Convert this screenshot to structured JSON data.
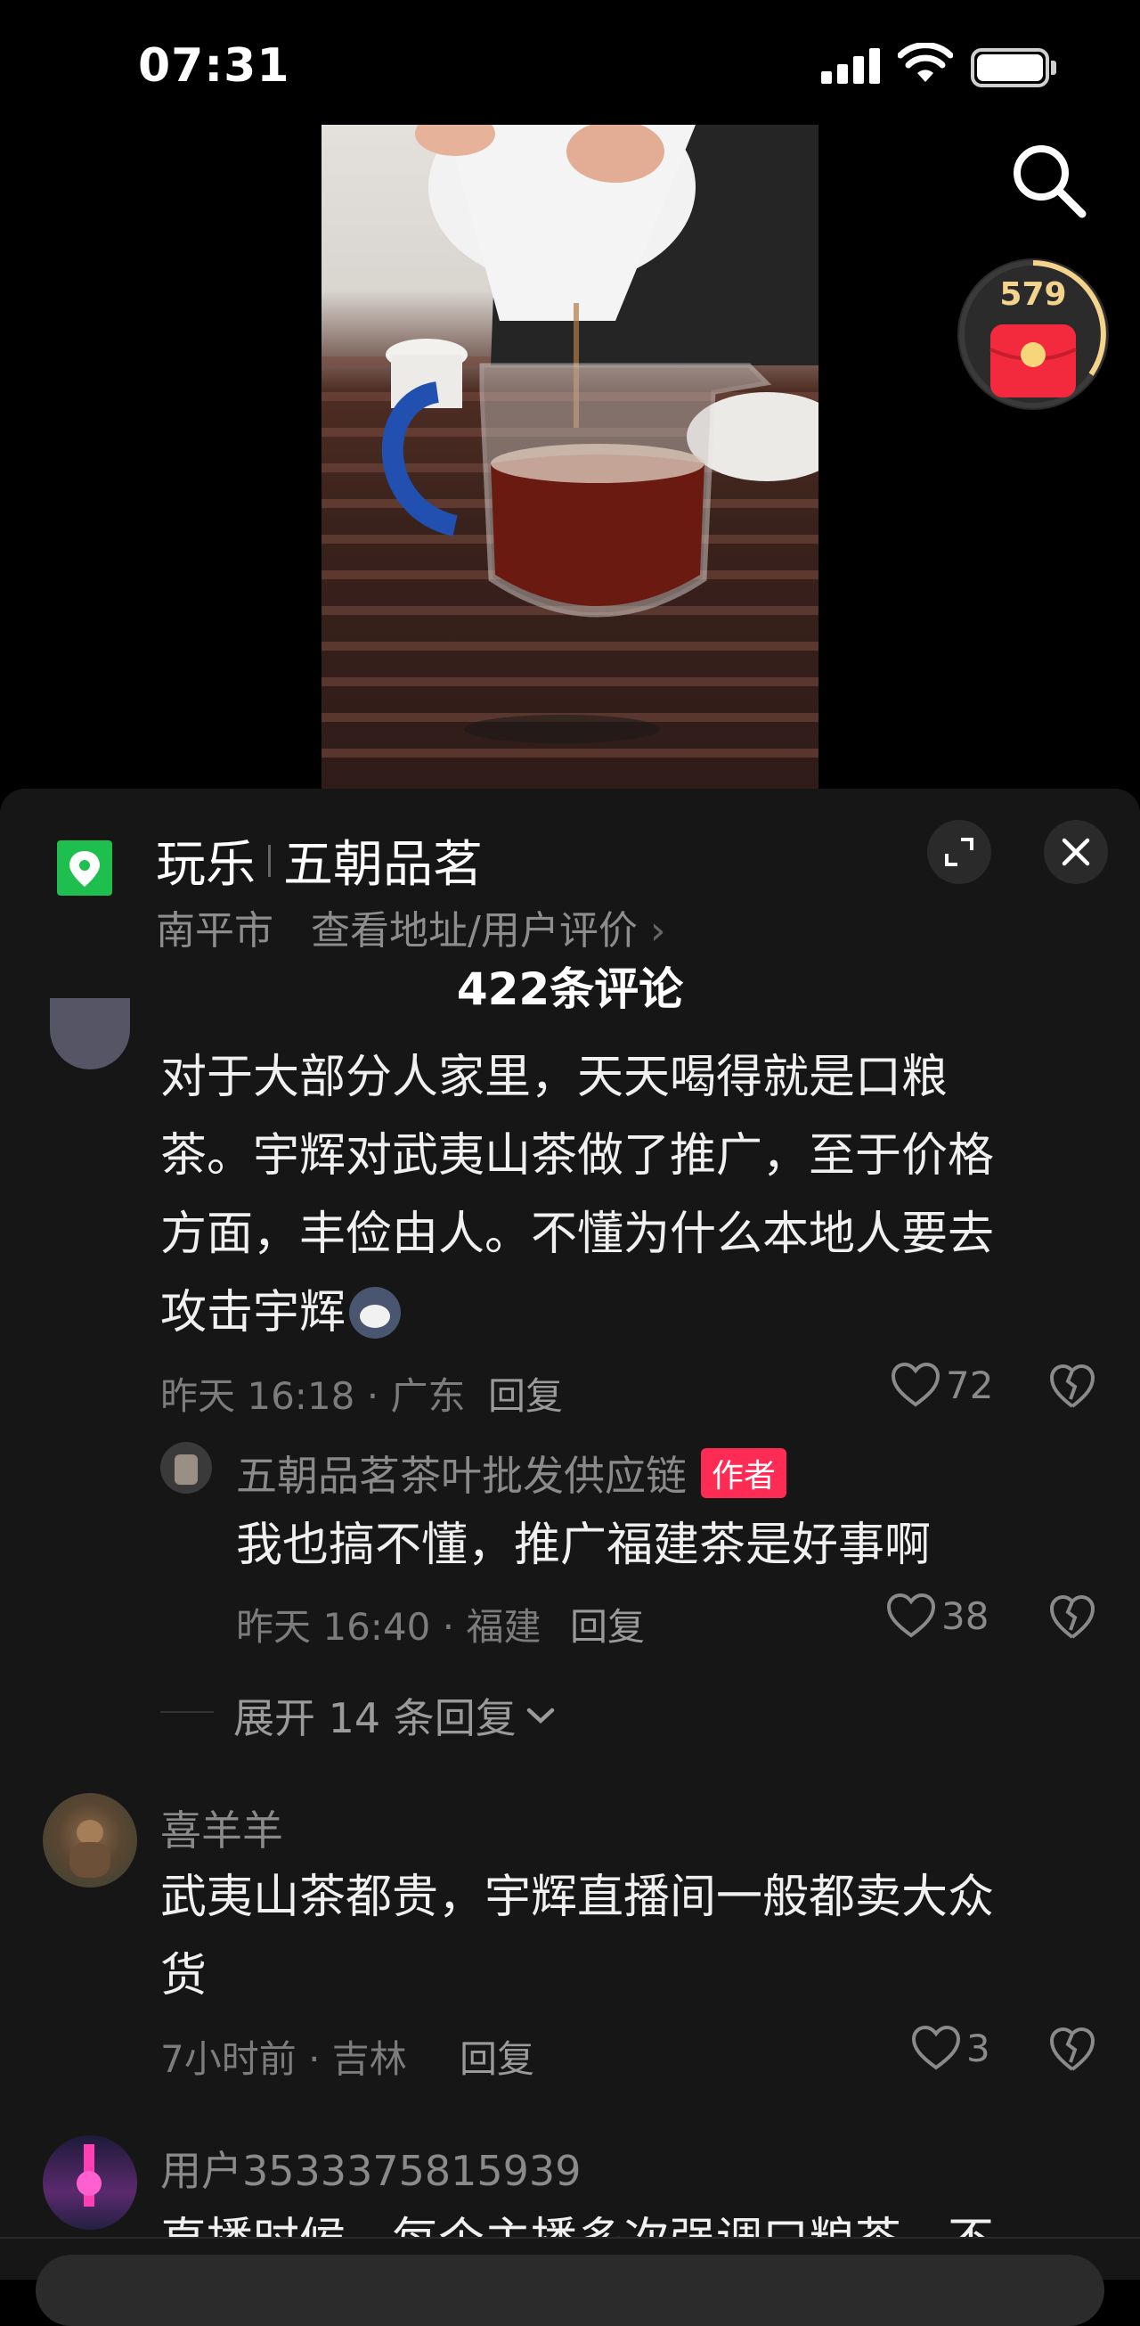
{
  "status_bar": {
    "time": "07:31"
  },
  "red_packet": {
    "count": "579"
  },
  "location": {
    "category": "玩乐",
    "name": "五朝品茗",
    "city": "南平市",
    "link_text": "查看地址/用户评价"
  },
  "comments_header": {
    "count_label": "422条评论"
  },
  "comments": [
    {
      "text_lines": [
        "对于大部分人家里，天天喝得就是口粮",
        "茶。宇辉对武夷山茶做了推广，至于价格",
        "方面，丰俭由人。不懂为什么本地人要去",
        "攻击宇辉"
      ],
      "meta": "昨天 16:18 · 广东",
      "reply_label": "回复",
      "likes": "72"
    },
    {
      "user": "五朝品茗茶叶批发供应链",
      "badge": "作者",
      "text": "我也搞不懂，推广福建茶是好事啊",
      "meta": "昨天 16:40 · 福建",
      "reply_label": "回复",
      "likes": "38"
    },
    {
      "user": "喜羊羊",
      "text_lines": [
        "武夷山茶都贵，宇辉直播间一般都卖大众",
        "货"
      ],
      "meta": "7小时前 · 吉林",
      "reply_label": "回复",
      "likes": "3"
    },
    {
      "user": "用户3533375815939",
      "text_partial": "直播时候，每个主播多次强调口粮茶，不"
    }
  ],
  "expand_replies": {
    "label": "展开 14 条回复"
  },
  "colors": {
    "accent_red": "#fe2c55",
    "location_green": "#1fbf4f",
    "panel_bg": "#161616"
  }
}
